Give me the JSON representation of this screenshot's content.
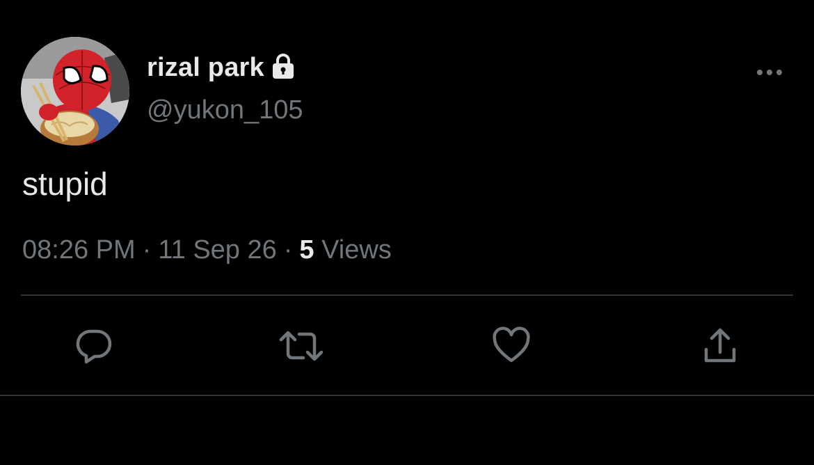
{
  "tweet": {
    "display_name": "rizal park",
    "handle": "@yukon_105",
    "text": "stupid",
    "time": "08:26 PM",
    "separator": "·",
    "date": "11 Sep 26",
    "views_count": "5",
    "views_label": "Views"
  },
  "icons": {
    "protected": "lock-icon",
    "more": "more-dots-icon",
    "reply": "reply-icon",
    "retweet": "retweet-icon",
    "like": "heart-icon",
    "share": "share-icon"
  },
  "colors": {
    "background": "#000000",
    "primary_text": "#e7e9ea",
    "secondary_text": "#71767b",
    "divider": "#2f3336"
  }
}
